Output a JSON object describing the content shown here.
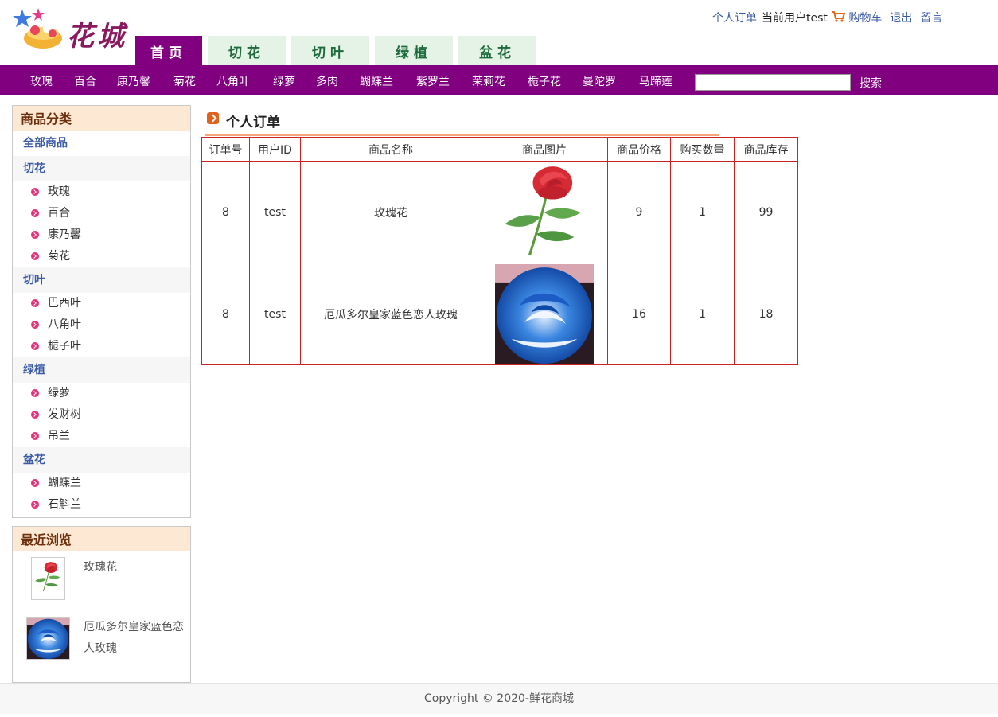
{
  "header": {
    "logo_text": "花城",
    "links": {
      "orders": "个人订单",
      "current_user": "当前用户test",
      "cart": "购物车",
      "logout": "退出",
      "message": "留言"
    },
    "tabs": [
      {
        "label": "首页",
        "active": true
      },
      {
        "label": "切花",
        "active": false
      },
      {
        "label": "切叶",
        "active": false
      },
      {
        "label": "绿植",
        "active": false
      },
      {
        "label": "盆花",
        "active": false
      }
    ]
  },
  "nav": {
    "items": [
      "玫瑰",
      "百合",
      "康乃馨",
      "菊花",
      "八角叶",
      "绿萝",
      "多肉",
      "蝴蝶兰",
      "紫罗兰",
      "茉莉花",
      "栀子花",
      "曼陀罗",
      "马蹄莲"
    ],
    "search_value": "",
    "search_label": "搜索"
  },
  "sidebar": {
    "categories_title": "商品分类",
    "all_label": "全部商品",
    "groups": [
      {
        "title": "切花",
        "items": [
          "玫瑰",
          "百合",
          "康乃馨",
          "菊花"
        ]
      },
      {
        "title": "切叶",
        "items": [
          "巴西叶",
          "八角叶",
          "栀子叶"
        ]
      },
      {
        "title": "绿植",
        "items": [
          "绿萝",
          "发财树",
          "吊兰"
        ]
      },
      {
        "title": "盆花",
        "items": [
          "蝴蝶兰",
          "石斛兰"
        ]
      }
    ],
    "recent_title": "最近浏览",
    "recent": [
      {
        "name": "玫瑰花",
        "image": "red-rose"
      },
      {
        "name": "厄瓜多尔皇家蓝色恋人玫瑰",
        "image": "blue-rose"
      }
    ]
  },
  "main": {
    "title": "个人订单",
    "columns": [
      "订单号",
      "用户ID",
      "商品名称",
      "商品图片",
      "商品价格",
      "购买数量",
      "商品库存"
    ],
    "rows": [
      {
        "order_id": "8",
        "user_id": "test",
        "name": "玫瑰花",
        "image": "red-rose",
        "price": "9",
        "qty": "1",
        "stock": "99"
      },
      {
        "order_id": "8",
        "user_id": "test",
        "name": "厄瓜多尔皇家蓝色恋人玫瑰",
        "image": "blue-rose",
        "price": "16",
        "qty": "1",
        "stock": "18"
      }
    ]
  },
  "footer": {
    "copyright": "Copyright © 2020-鲜花商城"
  },
  "colors": {
    "brand_purple": "#800080",
    "tab_bg": "#e5f3e7",
    "table_border": "#cc2222",
    "link_blue": "#3b5ba5",
    "accent_orange": "#e0611a"
  }
}
